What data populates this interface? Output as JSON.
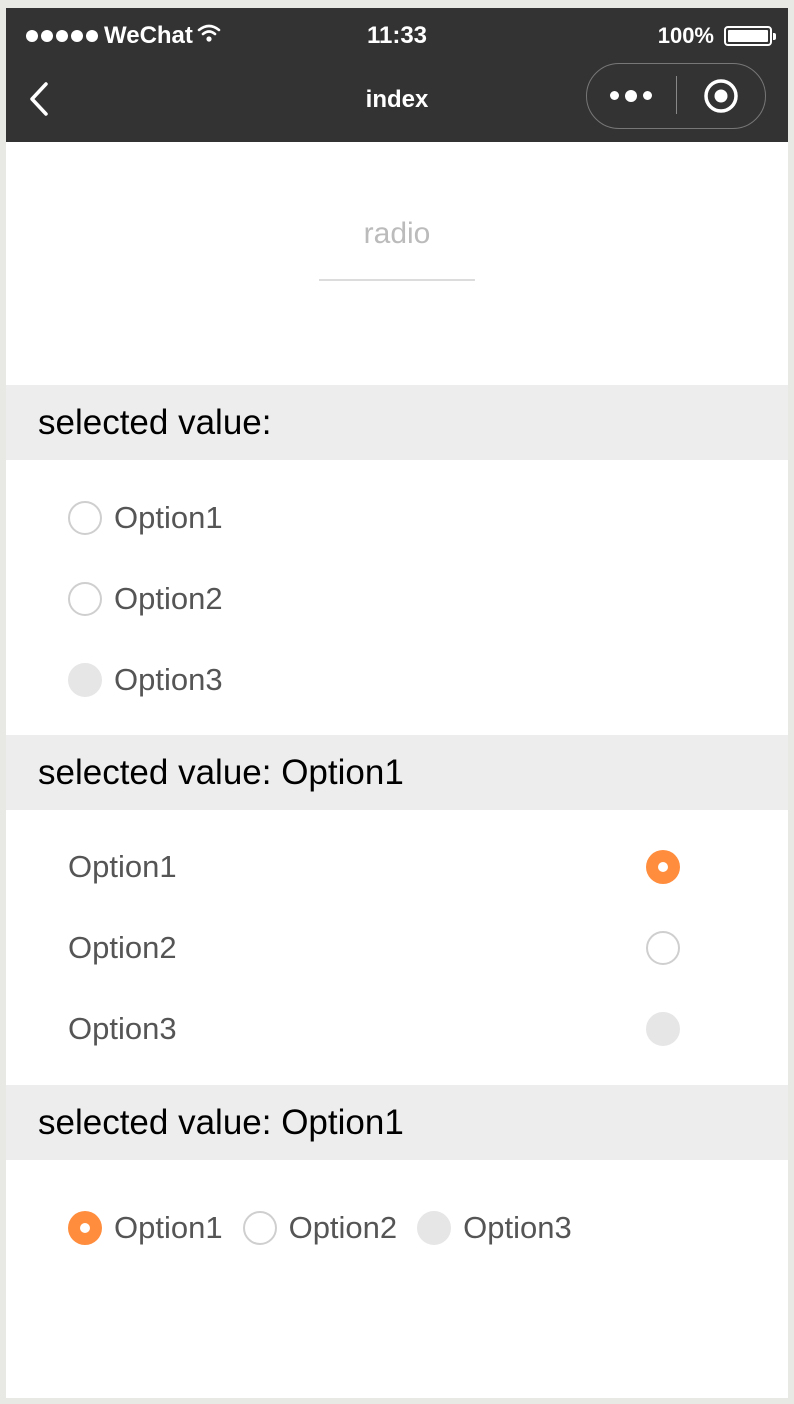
{
  "status_bar": {
    "carrier": "WeChat",
    "time": "11:33",
    "battery": "100%"
  },
  "nav": {
    "title": "index"
  },
  "header": {
    "title": "radio"
  },
  "sections": [
    {
      "label": "selected value:",
      "options": [
        {
          "label": "Option1",
          "state": "unchecked"
        },
        {
          "label": "Option2",
          "state": "unchecked"
        },
        {
          "label": "Option3",
          "state": "disabled"
        }
      ]
    },
    {
      "label": "selected value: Option1",
      "options": [
        {
          "label": "Option1",
          "state": "checked"
        },
        {
          "label": "Option2",
          "state": "unchecked"
        },
        {
          "label": "Option3",
          "state": "disabled"
        }
      ]
    },
    {
      "label": "selected value: Option1",
      "options": [
        {
          "label": "Option1",
          "state": "checked"
        },
        {
          "label": "Option2",
          "state": "unchecked"
        },
        {
          "label": "Option3",
          "state": "disabled"
        }
      ]
    }
  ],
  "colors": {
    "accent": "#ff8d3d",
    "topbar": "#333333",
    "section_bg": "#ededed"
  }
}
